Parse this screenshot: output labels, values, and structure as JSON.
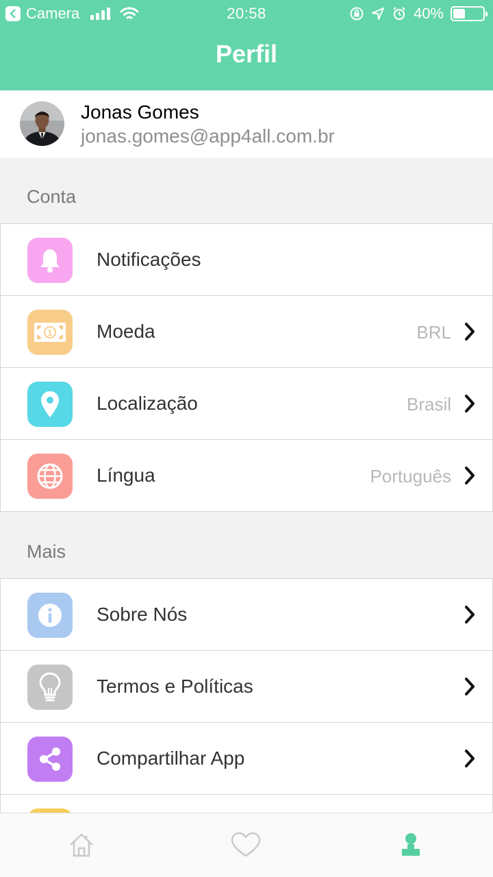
{
  "status_bar": {
    "back_app": "Camera",
    "time": "20:58",
    "battery": "40%",
    "battery_level": 0.4
  },
  "header": {
    "title": "Perfil"
  },
  "profile": {
    "name": "Jonas Gomes",
    "email": "jonas.gomes@app4all.com.br"
  },
  "sections": {
    "account": "Conta",
    "more": "Mais"
  },
  "account_items": [
    {
      "label": "Notificações",
      "value": "",
      "icon": "bell-icon",
      "color": "#f8a6f0"
    },
    {
      "label": "Moeda",
      "value": "BRL",
      "icon": "money-icon",
      "color": "#f8cd8a"
    },
    {
      "label": "Localização",
      "value": "Brasil",
      "icon": "location-pin-icon",
      "color": "#56d8e6"
    },
    {
      "label": "Língua",
      "value": "Português",
      "icon": "globe-icon",
      "color": "#fa9d96"
    }
  ],
  "more_items": [
    {
      "label": "Sobre Nós",
      "icon": "info-icon",
      "color": "#a9c9f0"
    },
    {
      "label": "Termos e Políticas",
      "icon": "lightbulb-icon",
      "color": "#c5c5c5"
    },
    {
      "label": "Compartilhar App",
      "icon": "share-icon",
      "color": "#c17ef2"
    }
  ],
  "tabbar": {
    "items": [
      "home-icon",
      "heart-icon",
      "profile-icon"
    ],
    "active_color": "#55cfa0",
    "inactive_color": "#c9c9c9"
  }
}
